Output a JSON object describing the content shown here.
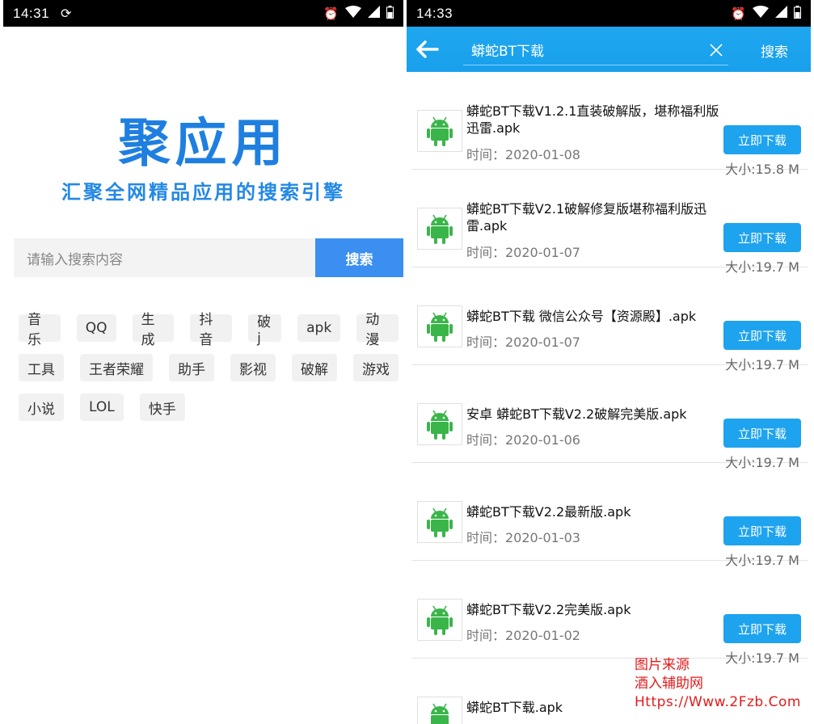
{
  "left": {
    "status": {
      "time": "14:31"
    },
    "logo": {
      "title": "聚应用",
      "subtitle": "汇聚全网精品应用的搜索引擎"
    },
    "search": {
      "placeholder": "请输入搜索内容",
      "button": "搜索"
    },
    "tags": [
      [
        "音乐",
        "QQ",
        "生成",
        "抖音",
        "破j",
        "apk",
        "动漫"
      ],
      [
        "工具",
        "王者荣耀",
        "助手",
        "影视",
        "破解",
        "游戏"
      ],
      [
        "小说",
        "LOL",
        "快手"
      ]
    ]
  },
  "right": {
    "status": {
      "time": "14:33"
    },
    "appbar": {
      "query": "蟒蛇BT下载",
      "search_label": "搜索"
    },
    "results": [
      {
        "title": "蟒蛇BT下载V1.2.1直装破解版，堪称福利版迅雷.apk",
        "time": "时间：2020-01-08",
        "button": "立即下载",
        "size": "大小:15.8 M"
      },
      {
        "title": "蟒蛇BT下载V2.1破解修复版堪称福利版迅雷.apk",
        "time": "时间：2020-01-07",
        "button": "立即下载",
        "size": "大小:19.7 M"
      },
      {
        "title": "蟒蛇BT下载 微信公众号【资源殿】.apk",
        "time": "时间：2020-01-07",
        "button": "立即下载",
        "size": "大小:19.7 M"
      },
      {
        "title": "安卓 蟒蛇BT下载V2.2破解完美版.apk",
        "time": "时间：2020-01-06",
        "button": "立即下载",
        "size": "大小:19.7 M"
      },
      {
        "title": "蟒蛇BT下载V2.2最新版.apk",
        "time": "时间：2020-01-03",
        "button": "立即下载",
        "size": "大小:19.7 M"
      },
      {
        "title": "蟒蛇BT下载V2.2完美版.apk",
        "time": "时间：2020-01-02",
        "button": "立即下载",
        "size": "大小:19.7 M"
      },
      {
        "title": "蟒蛇BT下载.apk"
      }
    ]
  },
  "watermark": {
    "line1": "图片来源",
    "line2": "酒入辅助网",
    "line3": "Https://Www.2Fzb.Com"
  },
  "colors": {
    "accent": "#1ea3ee",
    "logo": "#1f7fe0",
    "search_button": "#3a8ff0",
    "android_green": "#3ab54a",
    "watermark": "#e21b1b"
  }
}
